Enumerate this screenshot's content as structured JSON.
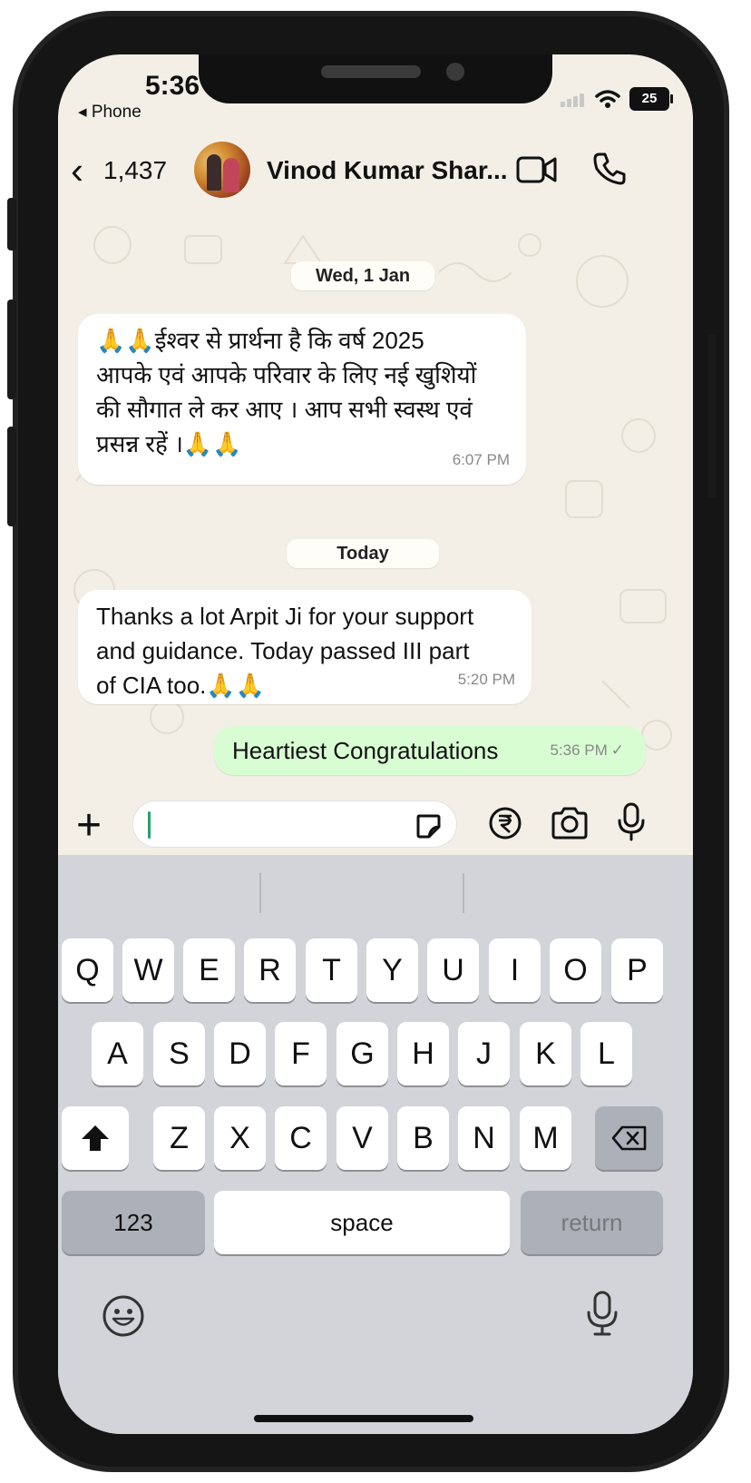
{
  "status_bar": {
    "time": "5:36",
    "back_app": "◂ Phone",
    "battery": "25"
  },
  "header": {
    "back_count": "1,437",
    "contact_name": "Vinod Kumar Shar..."
  },
  "chat": {
    "date1": "Wed, 1 Jan",
    "msg1": {
      "lines": [
        "🙏🙏ईश्वर से प्रार्थना है कि वर्ष 2025",
        "आपके एवं आपके परिवार के लिए नई खुशियों",
        "की सौगात ले कर आए । आप सभी स्वस्थ एवं",
        "प्रसन्न रहें ।🙏🙏"
      ],
      "time": "6:07 PM"
    },
    "date2": "Today",
    "msg2": {
      "lines": [
        "Thanks a lot Arpit Ji for your support",
        "and guidance. Today passed III part",
        "of CIA too.🙏🙏"
      ],
      "time": "5:20 PM"
    },
    "msg3": {
      "text": "Heartiest Congratulations",
      "time": "5:36 PM",
      "status": "✓"
    }
  },
  "input": {
    "value": ""
  },
  "keyboard": {
    "row1": [
      "Q",
      "W",
      "E",
      "R",
      "T",
      "Y",
      "U",
      "I",
      "O",
      "P"
    ],
    "row2": [
      "A",
      "S",
      "D",
      "F",
      "G",
      "H",
      "J",
      "K",
      "L"
    ],
    "row3": [
      "Z",
      "X",
      "C",
      "V",
      "B",
      "N",
      "M"
    ],
    "numbers": "123",
    "space": "space",
    "return": "return"
  }
}
